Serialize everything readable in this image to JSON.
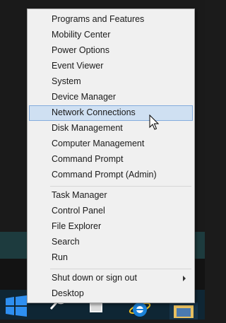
{
  "menu": {
    "items": [
      {
        "label": "Programs and Features"
      },
      {
        "label": "Mobility Center"
      },
      {
        "label": "Power Options"
      },
      {
        "label": "Event Viewer"
      },
      {
        "label": "System"
      },
      {
        "label": "Device Manager"
      },
      {
        "label": "Network Connections"
      },
      {
        "label": "Disk Management"
      },
      {
        "label": "Computer Management"
      },
      {
        "label": "Command Prompt"
      },
      {
        "label": "Command Prompt (Admin)"
      },
      {
        "label": "Task Manager"
      },
      {
        "label": "Control Panel"
      },
      {
        "label": "File Explorer"
      },
      {
        "label": "Search"
      },
      {
        "label": "Run"
      },
      {
        "label": "Shut down or sign out"
      },
      {
        "label": "Desktop"
      }
    ]
  },
  "taskbar": {
    "icons": [
      "windows-logo-icon",
      "search-icon",
      "task-view-icon",
      "internet-explorer-icon",
      "file-explorer-icon"
    ]
  },
  "colors": {
    "menu_background": "#f0f0f0",
    "highlight_background": "#cfe0f2",
    "highlight_border": "#84acdd",
    "taskbar": "#0f2634",
    "windows_logo": "#2e8ff0"
  }
}
